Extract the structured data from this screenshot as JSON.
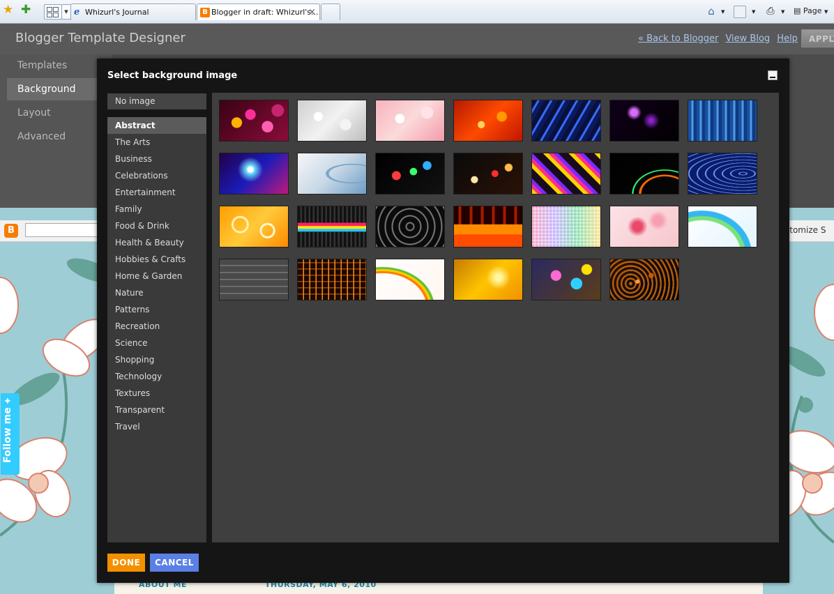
{
  "browser": {
    "tabs": [
      {
        "label": "Whizurl's Journal",
        "active": false
      },
      {
        "label": "Blogger in draft: Whizurl's...",
        "active": true
      }
    ],
    "tab_close_glyph": "×",
    "page_menu_label": "Page"
  },
  "designer": {
    "title": "Blogger Template Designer",
    "links": [
      "« Back to Blogger",
      "View Blog",
      "Help"
    ],
    "apply_label": "APPLY",
    "nav": [
      "Templates",
      "Background",
      "Layout",
      "Advanced"
    ],
    "selected_nav": "Background"
  },
  "blog_preview": {
    "customize_text": "stomize  S",
    "follow_label": "Follow me",
    "about_label": "ABOUT ME",
    "date_label": "THURSDAY, MAY 6, 2010",
    "colors": {
      "background": "#9fcdd6",
      "flower_fill": "#ffffff",
      "flower_outline": "#d9816c",
      "leaf": "#5b9a8c"
    }
  },
  "modal": {
    "title": "Select background image",
    "no_image_label": "No image",
    "categories": [
      "Abstract",
      "The Arts",
      "Business",
      "Celebrations",
      "Entertainment",
      "Family",
      "Food & Drink",
      "Health & Beauty",
      "Hobbies & Crafts",
      "Home & Garden",
      "Nature",
      "Patterns",
      "Recreation",
      "Science",
      "Shopping",
      "Technology",
      "Textures",
      "Transparent",
      "Travel"
    ],
    "selected_category": "Abstract",
    "thumbnails": [
      {
        "name": "pink-bokeh",
        "background": "radial-gradient(circle at 25% 55%, #ffb300 0 9%, transparent 10%), radial-gradient(circle at 45% 35%, #ff2e9a 0 11%, transparent 12%), radial-gradient(circle at 70% 65%, #ff5fb0 0 10%, transparent 11%), radial-gradient(circle at 85% 25%, #c6246e 0 9%, transparent 10%), linear-gradient(135deg, #3a0214, #8a0c3a)"
      },
      {
        "name": "silver-sparkle",
        "background": "radial-gradient(circle at 30% 40%, #ffffff 0 8%, transparent 9%), radial-gradient(circle at 70% 60%, #f4f4f4 0 10%, transparent 11%), linear-gradient(135deg, #cfcfcf, #f2f2f2, #bdbdbd)"
      },
      {
        "name": "pink-light",
        "background": "radial-gradient(circle at 35% 45%, #ffffff 0 9%, transparent 10%), radial-gradient(circle at 75% 30%, #ffe3e8 0 10%, transparent 11%), linear-gradient(135deg, #f7b3bd, #fbdada, #f39cab)"
      },
      {
        "name": "orange-glitter",
        "background": "radial-gradient(circle at 40% 60%, #ffd15a 0 7%, transparent 8%), radial-gradient(circle at 70% 40%, #ff9a00 0 9%, transparent 10%), linear-gradient(135deg, #b41a00, #ff4a00, #c01500)"
      },
      {
        "name": "blue-rays",
        "background": "repeating-linear-gradient(120deg, #08103c 0 6px, #3b6cff 7px 9px, #0b1a5c 10px 16px), linear-gradient(135deg, #000, #1a3fb0)"
      },
      {
        "name": "purple-lightning",
        "background": "radial-gradient(circle at 35% 30%, #d86cff 0 6%, transparent 14%), radial-gradient(circle at 60% 50%, #8d21c9 0 4%, transparent 18%), linear-gradient(135deg, #10001a, #020002)"
      },
      {
        "name": "blue-lines",
        "background": "repeating-linear-gradient(90deg, #1a4fa3 0 4px, #4e9be3 5px 7px, #0e3a80 8px 12px), linear-gradient(180deg, #0b2c70, #7ec2f0)"
      },
      {
        "name": "blue-starburst",
        "background": "radial-gradient(circle at 45% 40%, #ffffff 0 6%, #6ee0ff 9%, transparent 28%), linear-gradient(135deg, #210046, #1b1bb8, #c0197a)"
      },
      {
        "name": "silver-swirl",
        "background": "radial-gradient(ellipse at 80% 50%, transparent 0 30%, #7aa5c8 31% 34%, transparent 35%), linear-gradient(135deg, #f4f6f8, #c9d9e6, #6f9dc6)"
      },
      {
        "name": "rainbow-bokeh",
        "background": "radial-gradient(circle at 30% 55%, #ff3b3b 0 8%, transparent 9%), radial-gradient(circle at 55% 45%, #3bff6b 0 8%, transparent 9%), radial-gradient(circle at 75% 30%, #2eafff 0 7%, transparent 8%), linear-gradient(135deg, #000, #111)"
      },
      {
        "name": "night-bokeh",
        "background": "radial-gradient(circle at 30% 65%, #ffe7a8 0 6%, transparent 7%), radial-gradient(circle at 60% 50%, #ff2d2d 0 7%, transparent 8%), radial-gradient(circle at 80% 35%, #ffb94a 0 6%, transparent 7%), linear-gradient(135deg, #0a0a0a, #2a1106)"
      },
      {
        "name": "retro-stripes",
        "background": "repeating-linear-gradient(45deg, #ffd200 0 5px, #ff2e8a 6px 10px, #7a2bff 11px 15px, #1a0b1a 16px 26px)"
      },
      {
        "name": "light-trails",
        "background": "radial-gradient(ellipse at 80% 100%, transparent 0 30%, #ff6a00 31% 33%, transparent 34% 40%, #2bff75 41% 42%, transparent 43%), linear-gradient(135deg, #000, #060606)"
      },
      {
        "name": "blue-waves",
        "background": "repeating-radial-gradient(ellipse at 80% 50%, #0a1c6a 0 4px, #6f9cff 5px 6px, #0a1c6a 7px 12px)"
      },
      {
        "name": "orange-swirls",
        "background": "radial-gradient(circle at 30% 45%, transparent 0 12%, #fff0b0 13% 16%, transparent 17%), radial-gradient(circle at 70% 60%, transparent 0 10%, #fff6c9 11% 14%, transparent 15%), linear-gradient(135deg, #ff9d00, #ffca3a, #ff8a00)"
      },
      {
        "name": "neon-splash",
        "background": "linear-gradient(180deg, transparent 0 40%, #ff1f6a 41% 48%, #ffe600 49% 55%, #29c3ff 56% 62%, transparent 63%), repeating-linear-gradient(90deg, #111 0 3px, #333 4px 6px)"
      },
      {
        "name": "black-ornate",
        "background": "repeating-radial-gradient(circle at 50% 50%, #0b0b0b 0 4px, #7a7a7a 5px 6px, #0b0b0b 7px 10px)"
      },
      {
        "name": "flames",
        "background": "linear-gradient(0deg, #ff4c00 0 30%, #ff8a00 31% 55%, transparent 56%), repeating-linear-gradient(90deg, #220000 0 6px, #a71a00 7px 10px, #220000 11px 16px)"
      },
      {
        "name": "pastel-mosaic",
        "background": "repeating-linear-gradient(0deg, transparent 0 3px, rgba(255,255,255,0.5) 4px 5px), repeating-linear-gradient(90deg, transparent 0 3px, rgba(255,255,255,0.5) 4px 5px), linear-gradient(90deg, #f7a7c5, #c8b5ff, #8ae0b0, #ffe08c)"
      },
      {
        "name": "pink-watercolor",
        "background": "radial-gradient(circle at 40% 50%, #e8496a 0 10%, transparent 22%), radial-gradient(circle at 70% 35%, #f79eb0 0 8%, transparent 18%), linear-gradient(135deg, #fbe3e6, #f6c6cd)"
      },
      {
        "name": "rainbow-wave",
        "background": "radial-gradient(ellipse at 20% 120%, transparent 0 50%, #79e37a 51% 56%, #35b6f0 57% 64%, transparent 65%), linear-gradient(135deg, #ffffff, #e2f4ff)"
      },
      {
        "name": "gray-blocks",
        "background": "repeating-linear-gradient(0deg, #4a4a4a 0 8px, #777 9px 10px), repeating-linear-gradient(90deg, #3a3a3a 0 9px, #6a6a6a 10px 11px)"
      },
      {
        "name": "orange-circuit",
        "background": "repeating-linear-gradient(90deg, transparent 0 7px, #ff8c1a 8px 9px), repeating-linear-gradient(0deg, #1a0a00 0 7px, #a14300 8px 9px)"
      },
      {
        "name": "ribbon-curves",
        "background": "radial-gradient(ellipse at 10% 120%, transparent 0 50%, #ff7a00 51% 53%, #ffcc00 54% 56%, #5bc236 57% 59%, transparent 60%), linear-gradient(135deg, #ffffff, #fff6f0)"
      },
      {
        "name": "golden-glow",
        "background": "radial-gradient(circle at 65% 45%, #fff7a0 0 6%, transparent 24%), linear-gradient(135deg, #c77a00, #ffc400, #f09000)"
      },
      {
        "name": "graffiti",
        "background": "radial-gradient(circle at 35% 40%, #ff6ad5 0 10%, transparent 11%), radial-gradient(circle at 65% 60%, #2fd0ff 0 11%, transparent 12%), radial-gradient(circle at 80% 25%, #ffe100 0 8%, transparent 9%), linear-gradient(135deg, #2a2a60, #5a3d1a)"
      },
      {
        "name": "copper-dots",
        "background": "radial-gradient(circle at 40% 55%, #ff9a3a 0 4%, transparent 5%), radial-gradient(circle at 60% 40%, #c75b00 0 5%, transparent 6%), repeating-radial-gradient(circle at 30% 60%, #b55d10 0 2px, transparent 3px 6px), linear-gradient(135deg, #2b1400, #000)"
      }
    ],
    "done_label": "DONE",
    "cancel_label": "CANCEL",
    "colors": {
      "modal_bg": "#151515",
      "panel_bg": "#3f3f3f",
      "done": "#f49000",
      "cancel": "#5a80e6"
    }
  }
}
